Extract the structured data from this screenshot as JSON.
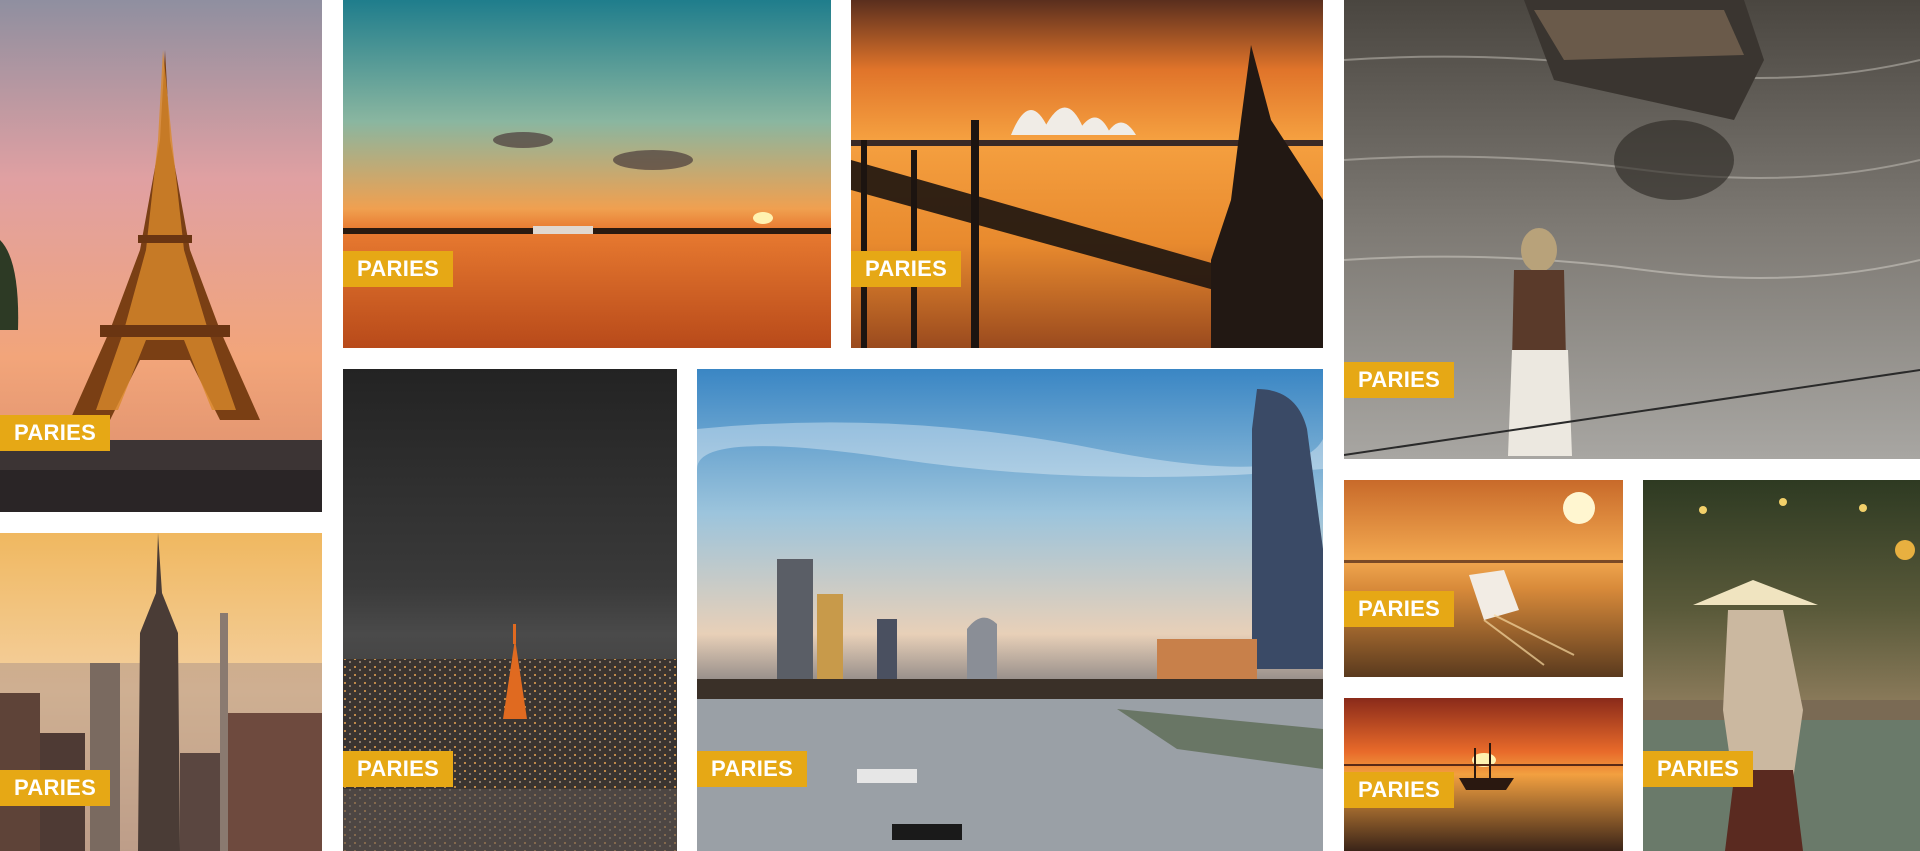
{
  "gallery": {
    "tiles": [
      {
        "id": "eiffel",
        "label": "PARIES",
        "subject": "Eiffel Tower at sunset"
      },
      {
        "id": "nyc",
        "label": "PARIES",
        "subject": "New York skyline at dusk"
      },
      {
        "id": "beach",
        "label": "PARIES",
        "subject": "Tropical sunset over sea"
      },
      {
        "id": "sydney",
        "label": "PARIES",
        "subject": "Sydney Opera House sunset"
      },
      {
        "id": "tokyo",
        "label": "PARIES",
        "subject": "Tokyo city at night"
      },
      {
        "id": "london",
        "label": "PARIES",
        "subject": "London skyline over Thames"
      },
      {
        "id": "river",
        "label": "PARIES",
        "subject": "Person wading near boat"
      },
      {
        "id": "cruise",
        "label": "PARIES",
        "subject": "Cruise ship at sunset"
      },
      {
        "id": "ship",
        "label": "PARIES",
        "subject": "Sailing ship at sunset"
      },
      {
        "id": "hoian",
        "label": "PARIES",
        "subject": "Woman with conical hat"
      }
    ]
  },
  "colors": {
    "tag_background": "#e6a815",
    "tag_text": "#ffffff"
  }
}
